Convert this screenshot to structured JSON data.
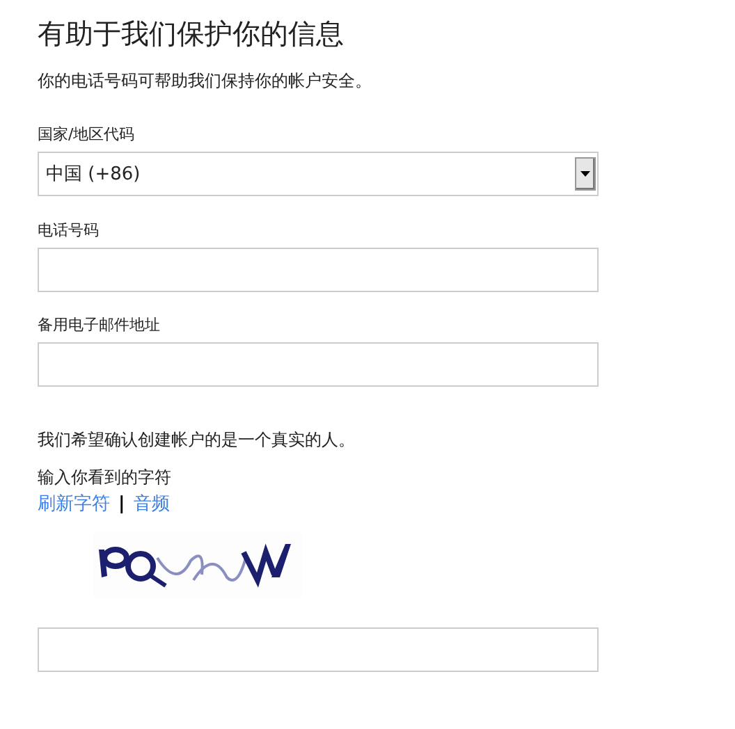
{
  "title": "有助于我们保护你的信息",
  "intro": "你的电话号码可帮助我们保持你的帐户安全。",
  "fields": [
    {
      "kind": "select",
      "label": "国家/地区代码",
      "value": "中国 (+86)"
    },
    {
      "kind": "text",
      "label": "电话号码"
    },
    {
      "kind": "text",
      "label": "备用电子邮件地址"
    }
  ],
  "captcha": {
    "note": "我们希望确认创建帐户的是一个真实的人。",
    "label": "输入你看到的字符",
    "links": [
      "刷新字符",
      "音频"
    ],
    "separator": "|",
    "image": {
      "kind": "picture"
    }
  }
}
